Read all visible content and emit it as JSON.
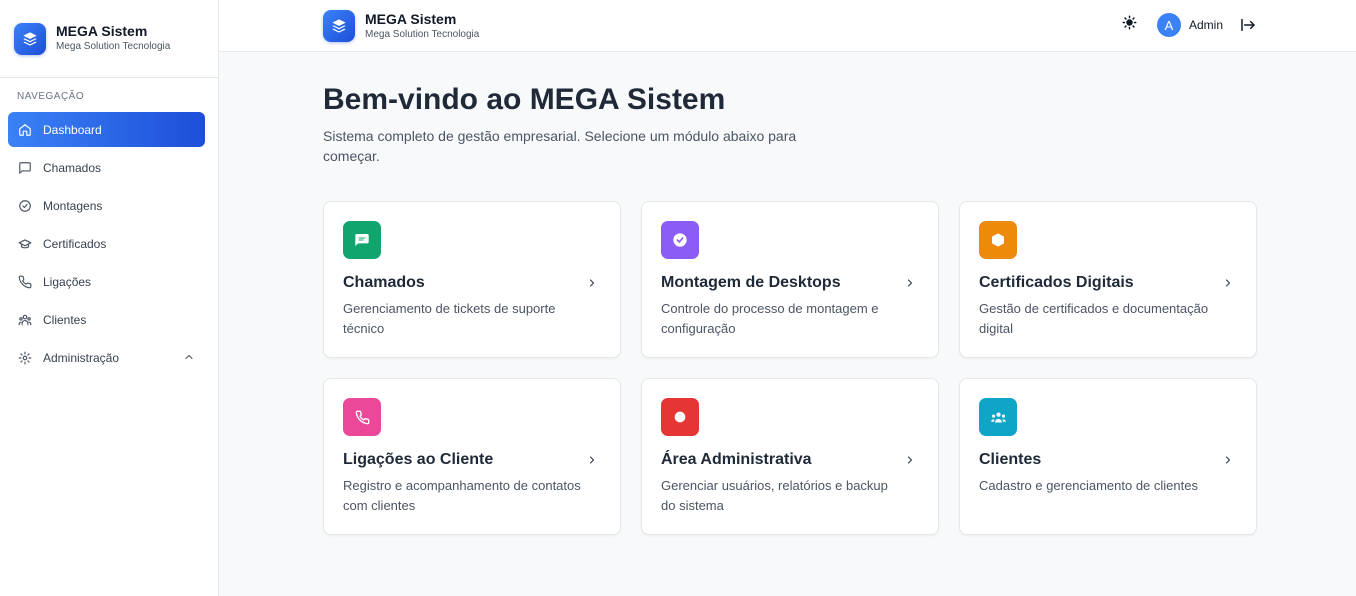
{
  "sidebar": {
    "brand_title": "MEGA Sistem",
    "brand_subtitle": "Mega Solution Tecnologia",
    "nav_label": "NAVEGAÇÃO",
    "items": [
      {
        "label": "Dashboard",
        "icon": "home-icon",
        "active": true
      },
      {
        "label": "Chamados",
        "icon": "message-square-icon"
      },
      {
        "label": "Montagens",
        "icon": "check-circle-icon"
      },
      {
        "label": "Certificados",
        "icon": "graduation-cap-icon"
      },
      {
        "label": "Ligações",
        "icon": "phone-icon"
      },
      {
        "label": "Clientes",
        "icon": "users-icon"
      },
      {
        "label": "Administração",
        "icon": "settings-icon",
        "expandable": true
      }
    ]
  },
  "header": {
    "brand_title": "MEGA Sistem",
    "brand_subtitle": "Mega Solution Tecnologia",
    "theme_toggle_icon": "sun-icon",
    "user_initial": "A",
    "user_name": "Admin",
    "logout_icon": "logout-icon"
  },
  "main": {
    "title": "Bem-vindo ao MEGA Sistem",
    "subtitle": "Sistema completo de gestão empresarial. Selecione um módulo abaixo para começar.",
    "cards": [
      {
        "title": "Chamados",
        "description": "Gerenciamento de tickets de suporte técnico",
        "icon": "message-square-icon",
        "color": "#10a56f"
      },
      {
        "title": "Montagem de Desktops",
        "description": "Controle do processo de montagem e configuração",
        "icon": "check-circle-icon",
        "color": "#8b5cf6"
      },
      {
        "title": "Certificados Digitais",
        "description": "Gestão de certificados e documentação digital",
        "icon": "shield-icon",
        "color": "#ee8a0a"
      },
      {
        "title": "Ligações ao Cliente",
        "description": "Registro e acompanhamento de contatos com clientes",
        "icon": "phone-icon",
        "color": "#ec4899"
      },
      {
        "title": "Área Administrativa",
        "description": "Gerenciar usuários, relatórios e backup do sistema",
        "icon": "settings-icon",
        "color": "#e53535"
      },
      {
        "title": "Clientes",
        "description": "Cadastro e gerenciamento de clientes",
        "icon": "users-icon",
        "color": "#0ea5c6"
      }
    ]
  },
  "colors": {
    "accent": "#2563eb",
    "background": "#f8f9fb",
    "sidebar_bg": "#ffffff"
  }
}
